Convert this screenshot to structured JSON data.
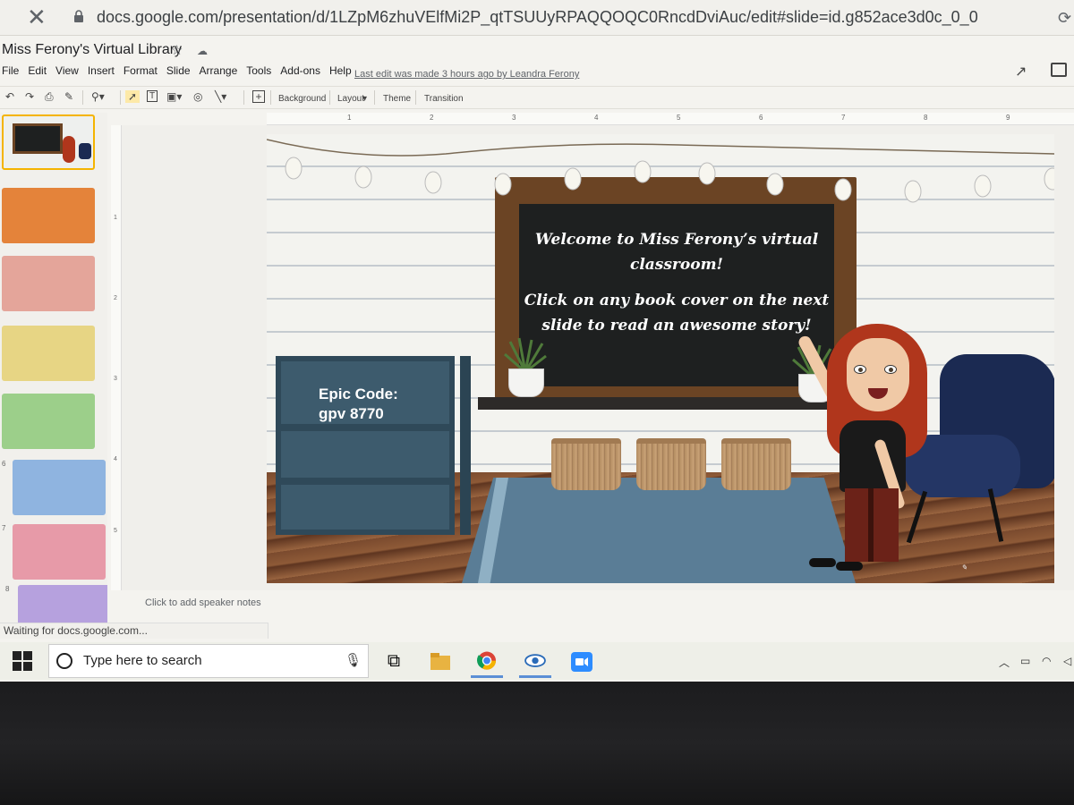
{
  "browser": {
    "url": "docs.google.com/presentation/d/1LZpM6zhuVElfMi2P_qtTSUUyRPAQQOQC0RncdDviAuc/edit#slide=id.g852ace3d0c_0_0"
  },
  "app": {
    "title": "Miss Ferony's Virtual Library",
    "menu": [
      "File",
      "Edit",
      "View",
      "Insert",
      "Format",
      "Slide",
      "Arrange",
      "Tools",
      "Add-ons",
      "Help"
    ],
    "last_edit": "Last edit was made 3 hours ago by Leandra Ferony"
  },
  "toolbar": {
    "background": "Background",
    "layout": "Layout",
    "theme": "Theme",
    "transition": "Transition"
  },
  "ruler": {
    "h": [
      "1",
      "2",
      "3",
      "4",
      "5",
      "6",
      "7",
      "8",
      "9"
    ],
    "v": [
      "1",
      "2",
      "3",
      "4",
      "5"
    ]
  },
  "filmstrip": {
    "numbers": [
      "6",
      "7",
      "8"
    ]
  },
  "slide": {
    "board_line1": "Welcome to Miss Ferony’s virtual classroom!",
    "board_line2": "Click on any book cover on the next slide to read an awesome story!",
    "epic_line1": "Epic Code:",
    "epic_line2": "gpv 8770"
  },
  "notes": {
    "placeholder": "Click to add speaker notes"
  },
  "status": {
    "text": "Waiting for docs.google.com..."
  },
  "taskbar": {
    "search_placeholder": "Type here to search"
  }
}
